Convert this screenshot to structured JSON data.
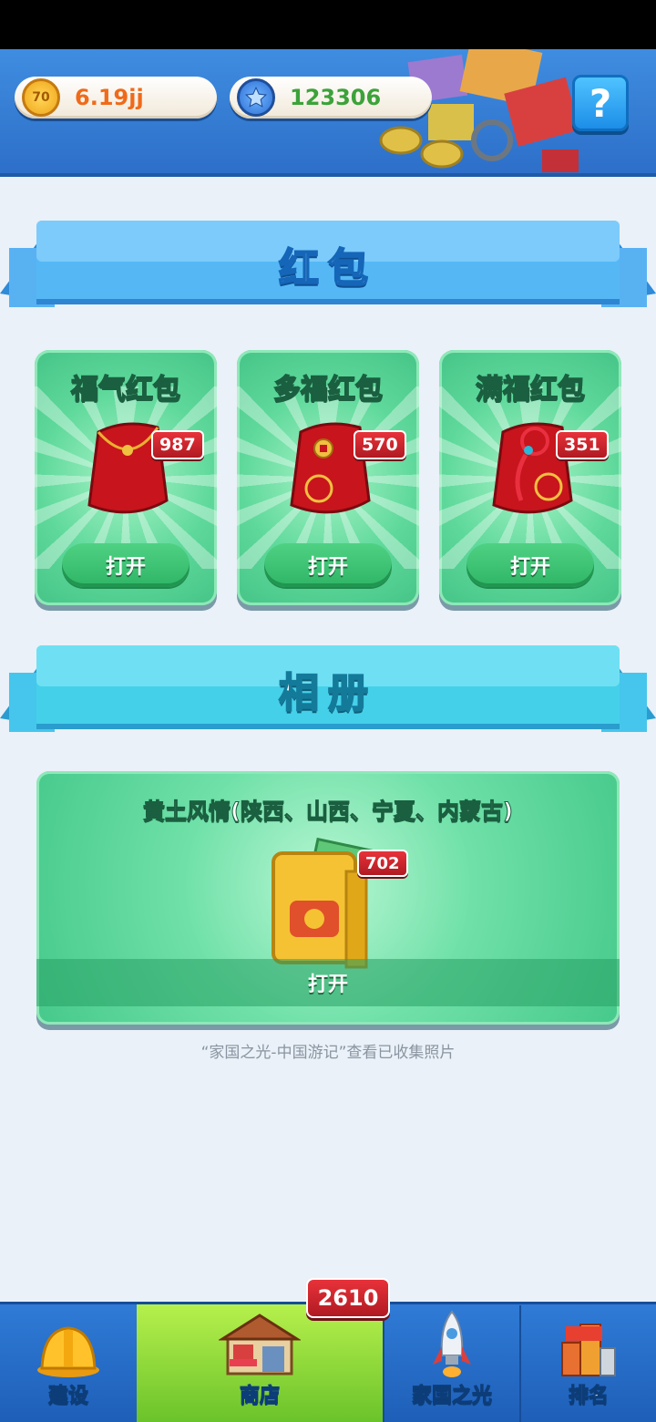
{
  "header": {
    "coins_value": "6.19jj",
    "coin_icon_text": "70",
    "gems_value": "123306",
    "help_label": "?"
  },
  "red_packets": {
    "section_title": "红包",
    "cards": [
      {
        "title": "福气红包",
        "count": "987",
        "button": "打开"
      },
      {
        "title": "多福红包",
        "count": "570",
        "button": "打开"
      },
      {
        "title": "满福红包",
        "count": "351",
        "button": "打开"
      }
    ]
  },
  "album": {
    "section_title": "相册",
    "title": "黄土风情(陕西、山西、宁夏、内蒙古)",
    "count": "702",
    "button": "打开",
    "hint": "“家国之光-中国游记”查看已收集照片"
  },
  "bottom_nav": {
    "items": [
      {
        "label": "建设",
        "icon": "hardhat-icon"
      },
      {
        "label": "商店",
        "icon": "shop-icon"
      },
      {
        "label": "家国之光",
        "icon": "rocket-icon"
      },
      {
        "label": "排名",
        "icon": "ranking-icon"
      }
    ],
    "shop_badge": "2610",
    "active": "商店"
  },
  "colors": {
    "header_bg": "#3f8de0",
    "card_green": "#5fd99b",
    "badge_red": "#d02530",
    "nav_bg": "#2f7bd6",
    "nav_active": "#8fd83a"
  }
}
